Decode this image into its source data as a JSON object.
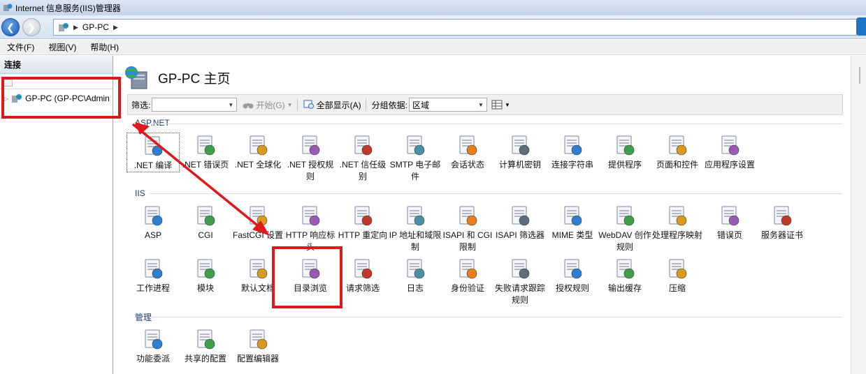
{
  "window": {
    "title": "Internet 信息服务(IIS)管理器"
  },
  "address": {
    "crumb": "GP-PC"
  },
  "menu": {
    "items": [
      "文件(F)",
      "视图(V)",
      "帮助(H)"
    ]
  },
  "connections": {
    "header": "连接",
    "tree_node": "GP-PC (GP-PC\\Admin"
  },
  "page": {
    "title": "GP-PC 主页"
  },
  "filterbar": {
    "filter_label": "筛选:",
    "start_label": "开始(G)",
    "showall_label": "全部显示(A)",
    "groupby_label": "分组依据:",
    "groupby_value": "区域"
  },
  "sections": {
    "aspnet": "ASP.NET",
    "iis": "IIS",
    "manage": "管理"
  },
  "features": {
    "aspnet": [
      {
        "label": ".NET 编译",
        "icon": "net-compile-icon"
      },
      {
        "label": ".NET 错误页",
        "icon": "net-error-page-icon"
      },
      {
        "label": ".NET 全球化",
        "icon": "globe-icon"
      },
      {
        "label": ".NET 授权规则",
        "icon": "authorization-rules-icon"
      },
      {
        "label": ".NET 信任级别",
        "icon": "trust-level-icon"
      },
      {
        "label": "SMTP 电子邮件",
        "icon": "smtp-email-icon"
      },
      {
        "label": "会话状态",
        "icon": "session-state-icon"
      },
      {
        "label": "计算机密钥",
        "icon": "machine-key-icon"
      },
      {
        "label": "连接字符串",
        "icon": "connection-string-icon"
      },
      {
        "label": "提供程序",
        "icon": "providers-icon"
      },
      {
        "label": "页面和控件",
        "icon": "pages-controls-icon"
      },
      {
        "label": "应用程序设置",
        "icon": "app-settings-icon"
      }
    ],
    "iis_row1": [
      {
        "label": "ASP",
        "icon": "asp-icon"
      },
      {
        "label": "CGI",
        "icon": "cgi-icon"
      },
      {
        "label": "FastCGI 设置",
        "icon": "fastcgi-icon"
      },
      {
        "label": "HTTP 响应标头",
        "icon": "http-headers-icon"
      },
      {
        "label": "HTTP 重定向",
        "icon": "http-redirect-icon"
      },
      {
        "label": "IP 地址和域限制",
        "icon": "ip-restriction-icon"
      },
      {
        "label": "ISAPI 和 CGI 限制",
        "icon": "isapi-cgi-icon"
      },
      {
        "label": "ISAPI 筛选器",
        "icon": "isapi-filter-icon"
      },
      {
        "label": "MIME 类型",
        "icon": "mime-type-icon"
      },
      {
        "label": "WebDAV 创作规则",
        "icon": "webdav-icon"
      },
      {
        "label": "处理程序映射",
        "icon": "handler-mapping-icon"
      },
      {
        "label": "错误页",
        "icon": "error-page-icon"
      },
      {
        "label": "服务器证书",
        "icon": "server-cert-icon"
      }
    ],
    "iis_row2": [
      {
        "label": "工作进程",
        "icon": "worker-process-icon"
      },
      {
        "label": "模块",
        "icon": "modules-icon"
      },
      {
        "label": "默认文档",
        "icon": "default-doc-icon"
      },
      {
        "label": "目录浏览",
        "icon": "directory-browsing-icon"
      },
      {
        "label": "请求筛选",
        "icon": "request-filtering-icon"
      },
      {
        "label": "日志",
        "icon": "logging-icon"
      },
      {
        "label": "身份验证",
        "icon": "authentication-icon"
      },
      {
        "label": "失败请求跟踪规则",
        "icon": "failed-request-icon"
      },
      {
        "label": "授权规则",
        "icon": "authorization-icon"
      },
      {
        "label": "输出缓存",
        "icon": "output-cache-icon"
      },
      {
        "label": "压缩",
        "icon": "compression-icon"
      }
    ],
    "manage": [
      {
        "label": "功能委派",
        "icon": "feature-delegation-icon"
      },
      {
        "label": "共享的配置",
        "icon": "shared-config-icon"
      },
      {
        "label": "配置编辑器",
        "icon": "config-editor-icon"
      }
    ]
  },
  "colors": {
    "annotation": "#e0181b",
    "accent": "#1c5cb7"
  }
}
